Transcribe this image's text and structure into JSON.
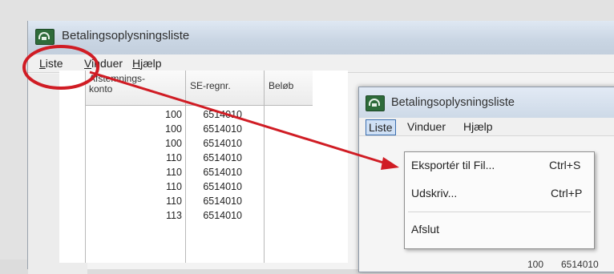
{
  "main_window": {
    "title": "Betalingsoplysningsliste",
    "menu": [
      "Liste",
      "Vinduer",
      "Hjælp"
    ]
  },
  "table": {
    "headers": [
      "Afstemnings-\nkonto",
      "SE-regnr.",
      "Beløb"
    ],
    "rows": [
      [
        "100",
        "6514010"
      ],
      [
        "100",
        "6514010"
      ],
      [
        "100",
        "6514010"
      ],
      [
        "110",
        "6514010"
      ],
      [
        "110",
        "6514010"
      ],
      [
        "110",
        "6514010"
      ],
      [
        "110",
        "6514010"
      ],
      [
        "113",
        "6514010"
      ]
    ]
  },
  "zoom_window": {
    "title": "Betalingsoplysningsliste",
    "menu": [
      "Liste",
      "Vinduer",
      "Hjælp"
    ],
    "dropdown": [
      {
        "label": "Eksportér til Fil...",
        "shortcut": "Ctrl+S"
      },
      {
        "label": "Udskriv...",
        "shortcut": "Ctrl+P"
      },
      {
        "label": "Afslut",
        "shortcut": ""
      }
    ],
    "peek_row": [
      "100",
      "6514010"
    ]
  },
  "colors": {
    "annotation": "#d01c24",
    "titlebar": "#c9d5e3",
    "menu_highlight": "#cfe0f5"
  }
}
